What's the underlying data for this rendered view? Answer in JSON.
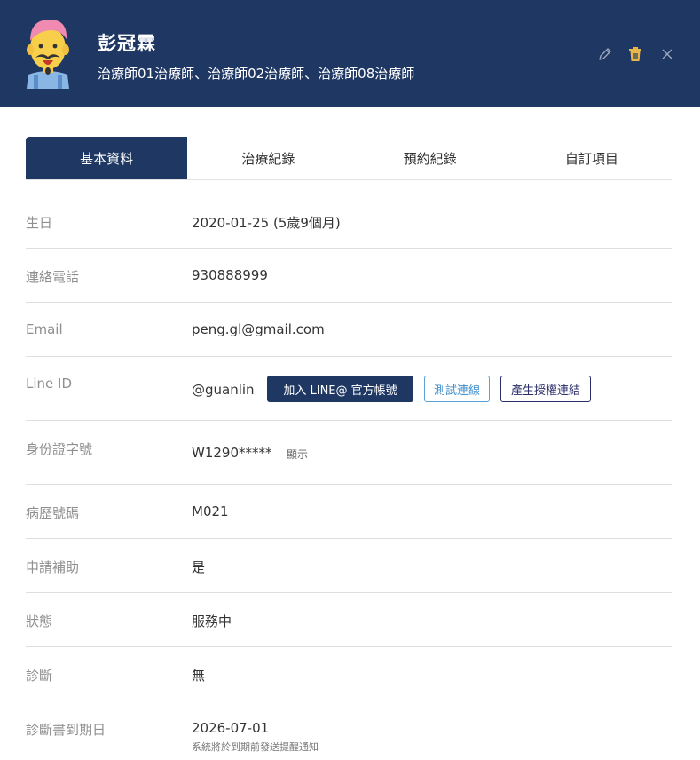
{
  "header": {
    "name": "彭冠霖",
    "therapists": "治療師01治療師、治療師02治療師、治療師08治療師",
    "icons": [
      "edit-icon",
      "trash-icon",
      "close-icon"
    ],
    "colors": {
      "header_bg": "#1f3763",
      "trash": "#e8b64a"
    }
  },
  "tabs": [
    {
      "label": "基本資料",
      "active": true
    },
    {
      "label": "治療紀錄",
      "active": false
    },
    {
      "label": "預約紀錄",
      "active": false
    },
    {
      "label": "自訂項目",
      "active": false
    }
  ],
  "fields": {
    "birthday": {
      "label": "生日",
      "value": "2020-01-25 (5歲9個月)"
    },
    "phone": {
      "label": "連絡電話",
      "value": "930888999"
    },
    "email": {
      "label": "Email",
      "value": "peng.gl@gmail.com"
    },
    "line": {
      "label": "Line ID",
      "value": "@guanlin",
      "join_button": "加入 LINE@ 官方帳號",
      "test_button": "測試連線",
      "auth_button": "產生授權連結"
    },
    "id_number": {
      "label": "身份證字號",
      "value": "W1290*****",
      "show_link": "顯示"
    },
    "record_no": {
      "label": "病歷號碼",
      "value": "M021"
    },
    "subsidy": {
      "label": "申請補助",
      "value": "是"
    },
    "status": {
      "label": "狀態",
      "value": "服務中"
    },
    "diagnosis": {
      "label": "診斷",
      "value": "無"
    },
    "diagnosis_due": {
      "label": "診斷書到期日",
      "value": "2026-07-01",
      "note": "系統將於到期前發送提醒通知"
    }
  }
}
